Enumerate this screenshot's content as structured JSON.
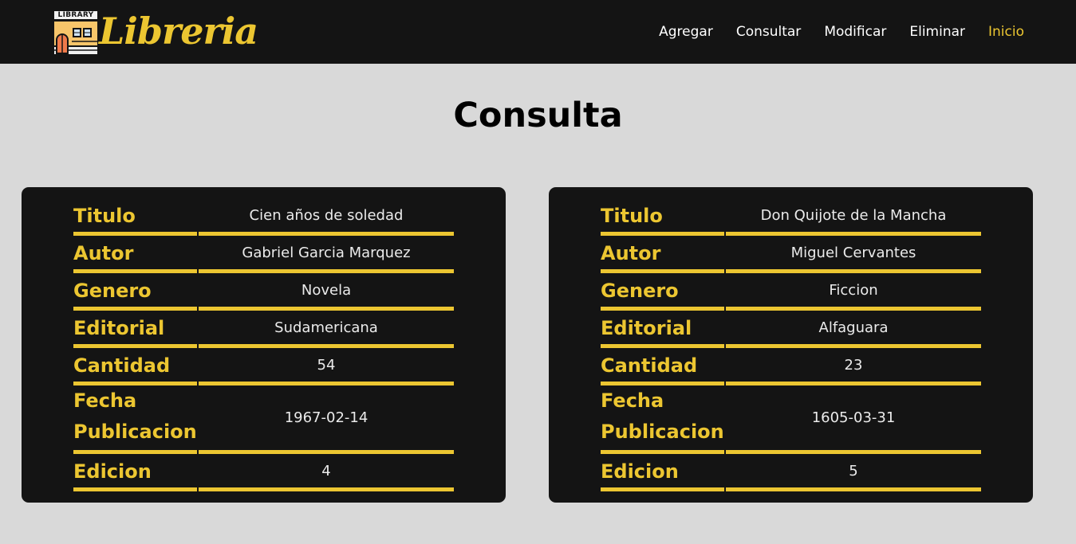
{
  "brand": {
    "badge": "LIBRARY",
    "name": "Libreria",
    "icon": "library-building-icon"
  },
  "nav": {
    "items": [
      {
        "label": "Agregar"
      },
      {
        "label": "Consultar"
      },
      {
        "label": "Modificar"
      },
      {
        "label": "Eliminar"
      },
      {
        "label": "Inicio"
      }
    ],
    "active": "Inicio"
  },
  "page": {
    "title": "Consulta"
  },
  "labels": {
    "titulo": "Titulo",
    "autor": "Autor",
    "genero": "Genero",
    "editorial": "Editorial",
    "cantidad": "Cantidad",
    "fecha": "Fecha Publicacion",
    "edicion": "Edicion"
  },
  "books": [
    {
      "titulo": "Cien años de soledad",
      "autor": "Gabriel Garcia Marquez",
      "genero": "Novela",
      "editorial": "Sudamericana",
      "cantidad": "54",
      "fecha": "1967-02-14",
      "edicion": "4"
    },
    {
      "titulo": "Don Quijote de la Mancha",
      "autor": "Miguel Cervantes",
      "genero": "Ficcion",
      "editorial": "Alfaguara",
      "cantidad": "23",
      "fecha": "1605-03-31",
      "edicion": "5"
    }
  ],
  "colors": {
    "accent": "#ecc631",
    "nav_bg": "#141414",
    "page_bg": "#d9d9d9",
    "card_bg": "#141414"
  }
}
